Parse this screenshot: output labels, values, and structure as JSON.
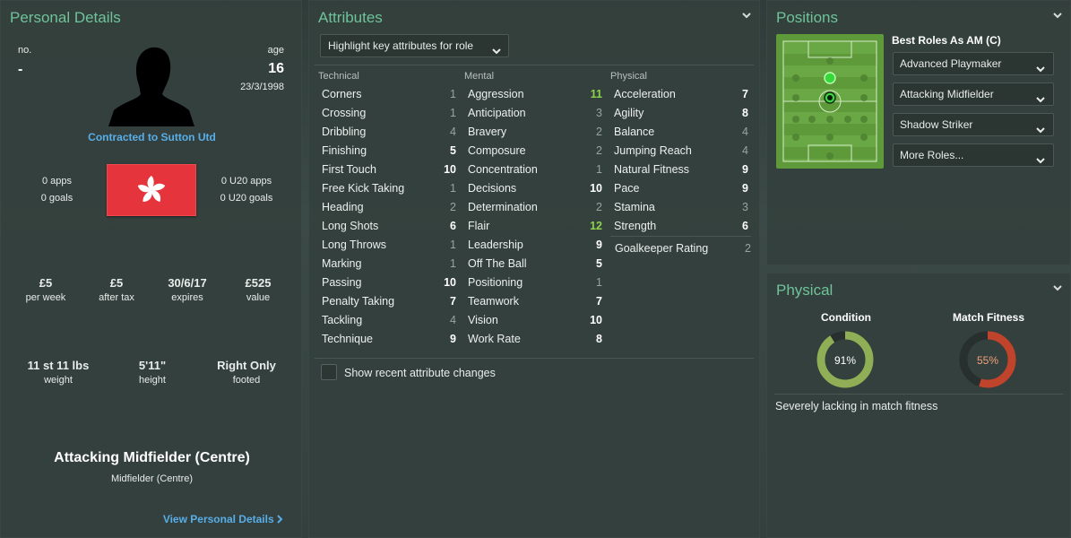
{
  "personal": {
    "title": "Personal Details",
    "no_label": "no.",
    "no_value": "-",
    "age_label": "age",
    "age_value": "16",
    "dob": "23/3/1998",
    "contract": "Contracted to Sutton Utd",
    "apps": "0 apps",
    "goals": "0 goals",
    "u20_apps": "0 U20 apps",
    "u20_goals": "0 U20 goals",
    "wage": {
      "value": "£5",
      "label": "per week"
    },
    "after_tax": {
      "value": "£5",
      "label": "after tax"
    },
    "expires": {
      "value": "30/6/17",
      "label": "expires"
    },
    "worth": {
      "value": "£525",
      "label": "value"
    },
    "weight": {
      "value": "11 st 11 lbs",
      "label": "weight"
    },
    "height": {
      "value": "5'11\"",
      "label": "height"
    },
    "footed": {
      "value": "Right Only",
      "label": "footed"
    },
    "position_main": "Attacking Midfielder (Centre)",
    "position_sub": "Midfielder (Centre)",
    "view_link": "View Personal Details",
    "flag_colors": {
      "bg": "#e6343d",
      "flower": "#ffffff"
    }
  },
  "attributes": {
    "title": "Attributes",
    "highlight_btn": "Highlight key attributes for role",
    "col_technical": "Technical",
    "col_mental": "Mental",
    "col_physical": "Physical",
    "technical": [
      {
        "name": "Corners",
        "value": "1"
      },
      {
        "name": "Crossing",
        "value": "1"
      },
      {
        "name": "Dribbling",
        "value": "4"
      },
      {
        "name": "Finishing",
        "value": "5"
      },
      {
        "name": "First Touch",
        "value": "10"
      },
      {
        "name": "Free Kick Taking",
        "value": "1"
      },
      {
        "name": "Heading",
        "value": "2"
      },
      {
        "name": "Long Shots",
        "value": "6"
      },
      {
        "name": "Long Throws",
        "value": "1"
      },
      {
        "name": "Marking",
        "value": "1"
      },
      {
        "name": "Passing",
        "value": "10"
      },
      {
        "name": "Penalty Taking",
        "value": "7"
      },
      {
        "name": "Tackling",
        "value": "4"
      },
      {
        "name": "Technique",
        "value": "9"
      }
    ],
    "mental": [
      {
        "name": "Aggression",
        "value": "11"
      },
      {
        "name": "Anticipation",
        "value": "3"
      },
      {
        "name": "Bravery",
        "value": "2"
      },
      {
        "name": "Composure",
        "value": "2"
      },
      {
        "name": "Concentration",
        "value": "1"
      },
      {
        "name": "Decisions",
        "value": "10"
      },
      {
        "name": "Determination",
        "value": "2"
      },
      {
        "name": "Flair",
        "value": "12"
      },
      {
        "name": "Leadership",
        "value": "9"
      },
      {
        "name": "Off The Ball",
        "value": "5"
      },
      {
        "name": "Positioning",
        "value": "1"
      },
      {
        "name": "Teamwork",
        "value": "7"
      },
      {
        "name": "Vision",
        "value": "10"
      },
      {
        "name": "Work Rate",
        "value": "8"
      }
    ],
    "physical": [
      {
        "name": "Acceleration",
        "value": "7"
      },
      {
        "name": "Agility",
        "value": "8"
      },
      {
        "name": "Balance",
        "value": "4"
      },
      {
        "name": "Jumping Reach",
        "value": "4"
      },
      {
        "name": "Natural Fitness",
        "value": "9"
      },
      {
        "name": "Pace",
        "value": "9"
      },
      {
        "name": "Stamina",
        "value": "3"
      },
      {
        "name": "Strength",
        "value": "6"
      }
    ],
    "gk_rating": {
      "name": "Goalkeeper Rating",
      "value": "2"
    },
    "show_changes": "Show recent attribute changes",
    "colors": {
      "high": "#ffffff",
      "low": "#9aa39f",
      "excellent": "#8bd44a"
    }
  },
  "positions": {
    "title": "Positions",
    "best_roles": "Best Roles As AM (C)",
    "roles": [
      "Advanced Playmaker",
      "Attacking Midfielder",
      "Shadow Striker",
      "More Roles..."
    ],
    "pitch_colors": {
      "grass": "#5e9a3a",
      "natural": "#3fd23f",
      "dot": "#1a2a1a"
    }
  },
  "physical": {
    "title": "Physical",
    "condition_label": "Condition",
    "condition_text": "91%",
    "condition_value": 0.91,
    "fitness_label": "Match Fitness",
    "fitness_text": "55%",
    "fitness_value": 0.55,
    "status": "Severely lacking in match fitness",
    "colors": {
      "condition": "#8fae55",
      "fitness": "#c0432b",
      "track": "#27302e"
    }
  }
}
